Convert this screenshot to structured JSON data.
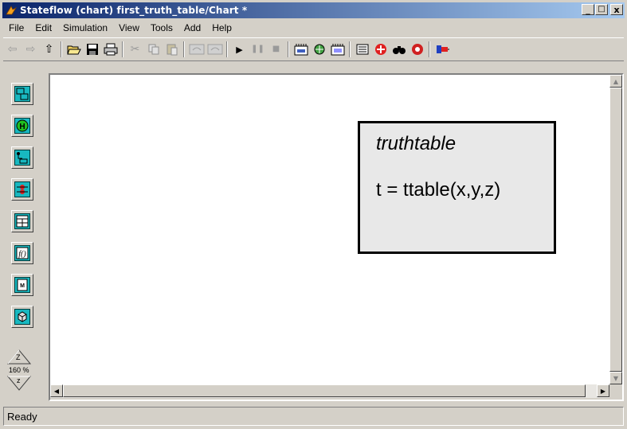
{
  "window": {
    "title": "Stateflow (chart) first_truth_table/Chart *",
    "minimize_label": "_",
    "maximize_label": "□",
    "close_label": "x"
  },
  "menu": [
    "File",
    "Edit",
    "Simulation",
    "View",
    "Tools",
    "Add",
    "Help"
  ],
  "palette": {
    "zoom_in_label": "Z",
    "zoom_level": "160 %",
    "zoom_out_label": "z"
  },
  "canvas": {
    "block_name": "truthtable",
    "block_signature": "t = ttable(x,y,z)"
  },
  "status": {
    "text": "Ready"
  },
  "colors": {
    "title_gradient_start": "#0a246a",
    "title_gradient_end": "#a6caf0",
    "palette_accent": "#18b8c0",
    "block_fill": "#e8e8e8"
  }
}
